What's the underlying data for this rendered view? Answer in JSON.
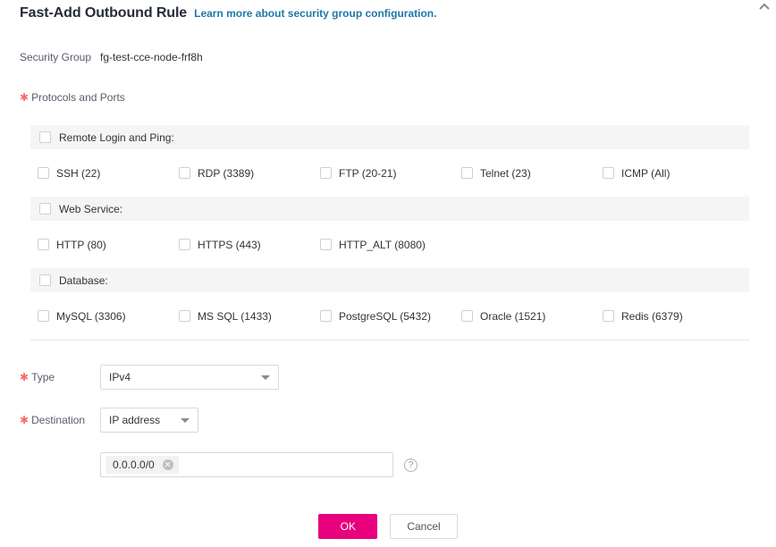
{
  "header": {
    "title": "Fast-Add Outbound Rule",
    "link_text": "Learn more about security group configuration.",
    "link_color": "#2077a8",
    "scroll_chevron_icon": "chevron-up-icon"
  },
  "fields": {
    "security_group_label": "Security Group",
    "security_group_value": "fg-test-cce-node-frf8h",
    "protocols_label": "Protocols and Ports",
    "type_label": "Type",
    "type_value": "IPv4",
    "destination_label": "Destination",
    "destination_value": "IP address",
    "ip_value": "0.0.0.0/0",
    "help_icon": "question-circle-icon",
    "required_marker": "✱"
  },
  "protocol_groups": [
    {
      "group_label": "Remote Login and Ping:",
      "options": [
        "SSH (22)",
        "RDP (3389)",
        "FTP (20-21)",
        "Telnet (23)",
        "ICMP (All)"
      ]
    },
    {
      "group_label": "Web Service:",
      "options": [
        "HTTP (80)",
        "HTTPS (443)",
        "HTTP_ALT (8080)"
      ]
    },
    {
      "group_label": "Database:",
      "options": [
        "MySQL (3306)",
        "MS SQL (1433)",
        "PostgreSQL (5432)",
        "Oracle (1521)",
        "Redis (6379)"
      ]
    }
  ],
  "footer": {
    "ok_label": "OK",
    "cancel_label": "Cancel",
    "ok_color": "#e8007d"
  }
}
